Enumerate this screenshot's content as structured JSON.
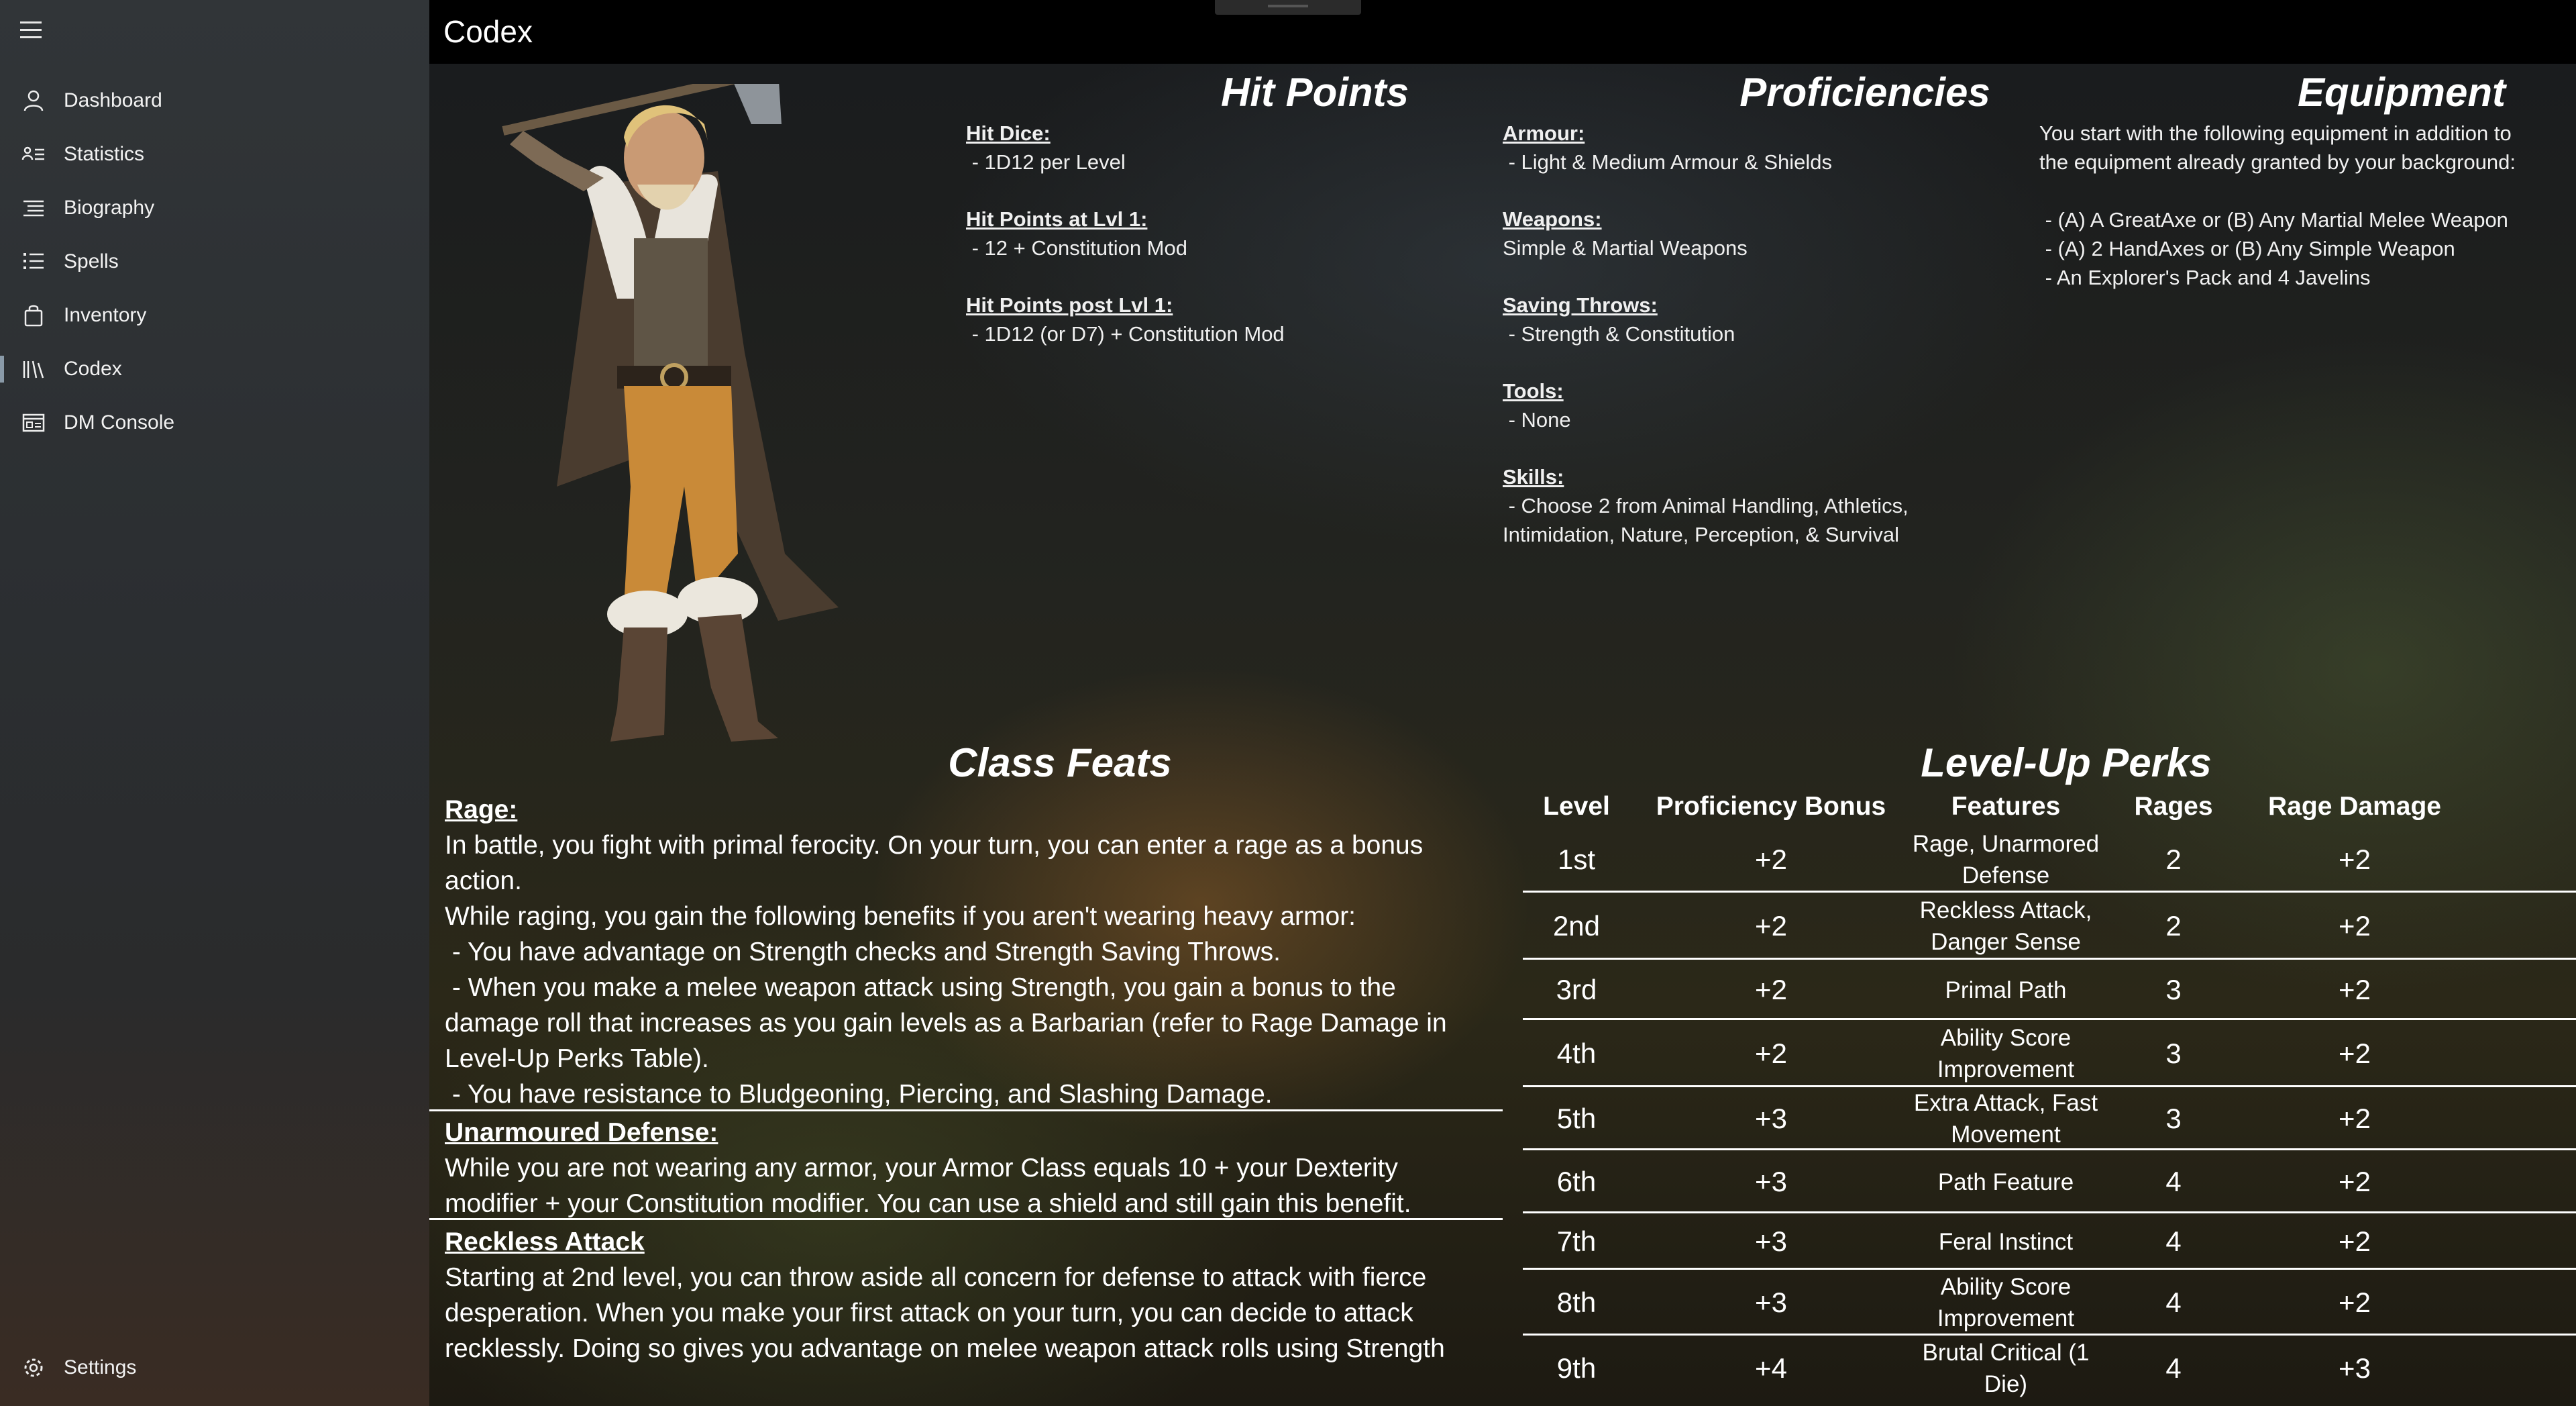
{
  "app": {
    "title": "Codex"
  },
  "sidebar": {
    "items": [
      {
        "label": "Dashboard",
        "icon": "person-icon"
      },
      {
        "label": "Statistics",
        "icon": "contact-card-icon"
      },
      {
        "label": "Biography",
        "icon": "list-icon"
      },
      {
        "label": "Spells",
        "icon": "bulleted-list-icon"
      },
      {
        "label": "Inventory",
        "icon": "bag-icon"
      },
      {
        "label": "Codex",
        "icon": "library-icon",
        "selected": true
      },
      {
        "label": "DM Console",
        "icon": "console-icon"
      }
    ],
    "settings": {
      "label": "Settings",
      "icon": "gear-icon"
    }
  },
  "hit_points": {
    "title": "Hit Points",
    "groups": [
      {
        "label": "Hit Dice:",
        "lines": [
          " - 1D12 per Level"
        ]
      },
      {
        "label": "Hit Points at Lvl 1:",
        "lines": [
          " - 12 + Constitution Mod"
        ]
      },
      {
        "label": "Hit Points post Lvl 1:",
        "lines": [
          " - 1D12 (or D7) + Constitution Mod"
        ]
      }
    ]
  },
  "proficiencies": {
    "title": "Proficiencies",
    "groups": [
      {
        "label": "Armour:",
        "lines": [
          " - Light & Medium Armour & Shields"
        ]
      },
      {
        "label": "Weapons:",
        "lines": [
          "Simple & Martial Weapons"
        ]
      },
      {
        "label": "Saving Throws:",
        "lines": [
          " - Strength & Constitution"
        ]
      },
      {
        "label": "Tools:",
        "lines": [
          " - None"
        ]
      },
      {
        "label": "Skills:",
        "lines": [
          " - Choose 2 from Animal Handling, Athletics,",
          "Intimidation, Nature, Perception, & Survival"
        ]
      }
    ]
  },
  "equipment": {
    "title": "Equipment",
    "intro": [
      "You start with the following equipment in addition to",
      "the equipment already granted by your background:"
    ],
    "items": [
      " - (A) A GreatAxe or (B) Any Martial Melee Weapon",
      " - (A) 2 HandAxes or (B) Any Simple Weapon",
      " - An Explorer's Pack and 4 Javelins"
    ]
  },
  "class_feats": {
    "title": "Class Feats",
    "feats": [
      {
        "name": "Rage:",
        "lines": [
          "In battle, you fight with primal ferocity. On your turn, you can enter a rage as a bonus",
          "action.",
          "While raging, you gain the following benefits if you aren't wearing heavy armor:",
          " - You have advantage on Strength checks and Strength Saving Throws.",
          " - When you make a melee weapon attack using Strength, you gain a bonus to the",
          "damage roll that increases as you gain levels as a Barbarian (refer to Rage Damage in",
          "Level-Up Perks Table).",
          " - You have resistance to Bludgeoning, Piercing, and Slashing Damage."
        ]
      },
      {
        "name": "Unarmoured Defense:",
        "lines": [
          "While you are not wearing any armor, your Armor Class equals 10 + your Dexterity",
          "modifier + your Constitution modifier. You can use a shield and still gain this benefit."
        ]
      },
      {
        "name": "Reckless Attack",
        "lines": [
          "Starting at 2nd level, you can throw aside all concern for defense to attack with fierce",
          "desperation. When you make your first attack on your turn, you can decide to attack",
          "recklessly. Doing so gives you advantage on melee weapon attack rolls using Strength"
        ]
      }
    ]
  },
  "level_up_perks": {
    "title": "Level-Up Perks",
    "headers": [
      "Level",
      "Proficiency Bonus",
      "Features",
      "Rages",
      "Rage Damage"
    ],
    "rows": [
      [
        "1st",
        "+2",
        "Rage, Unarmored Defense",
        "2",
        "+2"
      ],
      [
        "2nd",
        "+2",
        "Reckless Attack, Danger Sense",
        "2",
        "+2"
      ],
      [
        "3rd",
        "+2",
        "Primal Path",
        "3",
        "+2"
      ],
      [
        "4th",
        "+2",
        "Ability Score Improvement",
        "3",
        "+2"
      ],
      [
        "5th",
        "+3",
        "Extra Attack, Fast Movement",
        "3",
        "+2"
      ],
      [
        "6th",
        "+3",
        "Path Feature",
        "4",
        "+2"
      ],
      [
        "7th",
        "+3",
        "Feral Instinct",
        "4",
        "+2"
      ],
      [
        "8th",
        "+3",
        "Ability Score Improvement",
        "4",
        "+2"
      ],
      [
        "9th",
        "+4",
        "Brutal Critical (1 Die)",
        "4",
        "+3"
      ]
    ]
  }
}
